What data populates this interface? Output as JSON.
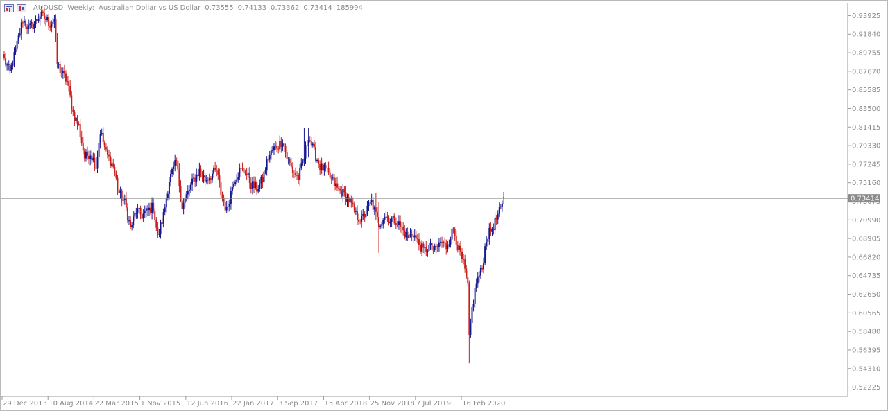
{
  "header": {
    "symbol": "AUDUSD",
    "timeframe": "Weekly:",
    "description": "Australian Dollar vs US Dollar",
    "open": "0.73555",
    "high": "0.74133",
    "low": "0.73362",
    "close": "0.73414",
    "volume": "185994"
  },
  "current_price_label": "0.73414",
  "y_axis_labels": [
    "0.93925",
    "0.91840",
    "0.89755",
    "0.87670",
    "0.85585",
    "0.83500",
    "0.81415",
    "0.79330",
    "0.77245",
    "0.75160",
    "0.73075",
    "0.70990",
    "0.68905",
    "0.66820",
    "0.64735",
    "0.62650",
    "0.60565",
    "0.58480",
    "0.56395",
    "0.54310",
    "0.52225"
  ],
  "x_axis_labels": [
    "29 Dec 2013",
    "10 Aug 2014",
    "22 Mar 2015",
    "1 Nov 2015",
    "12 Jun 2016",
    "22 Jan 2017",
    "3 Sep 2017",
    "15 Apr 2018",
    "25 Nov 2018",
    "7 Jul 2019",
    "16 Feb 2020"
  ],
  "colors": {
    "bull": "#16168f",
    "bear": "#c81e1e",
    "line": "#8c8c8c",
    "grid": "none"
  },
  "chart_data": {
    "type": "candlestick",
    "title": "AUDUSD Weekly: Australian Dollar vs US Dollar",
    "xlabel": "",
    "ylabel": "",
    "ylim": [
      0.5118,
      0.9497
    ],
    "current_price": 0.73414,
    "grid": false,
    "first_week": "29 Dec 2013",
    "anchors": [
      [
        "29 Dec 2013",
        0.89
      ],
      [
        "26 Jan 2014",
        0.875
      ],
      [
        "23 Feb 2014",
        0.9
      ],
      [
        "30 Mar 2014",
        0.935
      ],
      [
        "27 Apr 2014",
        0.925
      ],
      [
        "25 May 2014",
        0.93
      ],
      [
        "22 Jun 2014",
        0.94
      ],
      [
        "20 Jul 2014",
        0.935
      ],
      [
        "10 Aug 2014",
        0.93
      ],
      [
        "31 Aug 2014",
        0.935
      ],
      [
        "14 Sep 2014",
        0.885
      ],
      [
        "5 Oct 2014",
        0.875
      ],
      [
        "2 Nov 2014",
        0.865
      ],
      [
        "30 Nov 2014",
        0.83
      ],
      [
        "28 Dec 2014",
        0.815
      ],
      [
        "25 Jan 2015",
        0.78
      ],
      [
        "22 Feb 2015",
        0.785
      ],
      [
        "22 Mar 2015",
        0.77
      ],
      [
        "12 Apr 2015",
        0.81
      ],
      [
        "10 May 2015",
        0.785
      ],
      [
        "14 Jun 2015",
        0.77
      ],
      [
        "12 Jul 2015",
        0.74
      ],
      [
        "9 Aug 2015",
        0.73
      ],
      [
        "6 Sep 2015",
        0.7
      ],
      [
        "4 Oct 2015",
        0.72
      ],
      [
        "1 Nov 2015",
        0.715
      ],
      [
        "29 Nov 2015",
        0.72
      ],
      [
        "27 Dec 2015",
        0.725
      ],
      [
        "17 Jan 2016",
        0.69
      ],
      [
        "14 Feb 2016",
        0.715
      ],
      [
        "13 Mar 2016",
        0.755
      ],
      [
        "17 Apr 2016",
        0.775
      ],
      [
        "15 May 2016",
        0.725
      ],
      [
        "12 Jun 2016",
        0.74
      ],
      [
        "10 Jul 2016",
        0.755
      ],
      [
        "7 Aug 2016",
        0.765
      ],
      [
        "4 Sep 2016",
        0.755
      ],
      [
        "2 Oct 2016",
        0.76
      ],
      [
        "30 Oct 2016",
        0.765
      ],
      [
        "20 Nov 2016",
        0.74
      ],
      [
        "18 Dec 2016",
        0.72
      ],
      [
        "22 Jan 2017",
        0.755
      ],
      [
        "19 Feb 2017",
        0.765
      ],
      [
        "19 Mar 2017",
        0.765
      ],
      [
        "16 Apr 2017",
        0.75
      ],
      [
        "14 May 2017",
        0.745
      ],
      [
        "11 Jun 2017",
        0.755
      ],
      [
        "9 Jul 2017",
        0.78
      ],
      [
        "6 Aug 2017",
        0.79
      ],
      [
        "3 Sep 2017",
        0.795
      ],
      [
        "17 Sep 2017",
        0.8
      ],
      [
        "8 Oct 2017",
        0.78
      ],
      [
        "5 Nov 2017",
        0.765
      ],
      [
        "3 Dec 2017",
        0.757
      ],
      [
        "31 Dec 2017",
        0.78
      ],
      [
        "21 Jan 2018",
        0.805
      ],
      [
        "11 Feb 2018",
        0.79
      ],
      [
        "18 Mar 2018",
        0.77
      ],
      [
        "15 Apr 2018",
        0.765
      ],
      [
        "13 May 2018",
        0.755
      ],
      [
        "10 Jun 2018",
        0.745
      ],
      [
        "8 Jul 2018",
        0.74
      ],
      [
        "12 Aug 2018",
        0.73
      ],
      [
        "9 Sep 2018",
        0.715
      ],
      [
        "7 Oct 2018",
        0.71
      ],
      [
        "25 Nov 2018",
        0.73
      ],
      [
        "30 Dec 2018",
        0.705
      ],
      [
        "27 Jan 2019",
        0.715
      ],
      [
        "24 Feb 2019",
        0.71
      ],
      [
        "24 Mar 2019",
        0.71
      ],
      [
        "21 Apr 2019",
        0.7
      ],
      [
        "19 May 2019",
        0.69
      ],
      [
        "16 Jun 2019",
        0.695
      ],
      [
        "7 Jul 2019",
        0.685
      ],
      [
        "4 Aug 2019",
        0.675
      ],
      [
        "1 Sep 2019",
        0.68
      ],
      [
        "29 Sep 2019",
        0.675
      ],
      [
        "27 Oct 2019",
        0.685
      ],
      [
        "24 Nov 2019",
        0.68
      ],
      [
        "29 Dec 2019",
        0.7
      ],
      [
        "26 Jan 2020",
        0.675
      ],
      [
        "16 Feb 2020",
        0.66
      ],
      [
        "8 Mar 2020",
        0.635
      ],
      [
        "15 Mar 2020",
        0.575
      ],
      [
        "29 Mar 2020",
        0.61
      ],
      [
        "19 Apr 2020",
        0.64
      ],
      [
        "17 May 2020",
        0.655
      ],
      [
        "7 Jun 2020",
        0.69
      ],
      [
        "5 Jul 2020",
        0.7
      ],
      [
        "2 Aug 2020",
        0.715
      ],
      [
        "23 Aug 2020",
        0.725
      ],
      [
        "30 Aug 2020",
        0.734
      ]
    ],
    "spikes": [
      [
        "31 Dec 2017",
        0.8135,
        0.77
      ],
      [
        "21 Jan 2018",
        0.8135,
        0.78
      ],
      [
        "16 Dec 2018",
        0.74,
        0.71
      ],
      [
        "30 Dec 2018",
        0.73,
        0.673
      ],
      [
        "15 Mar 2020",
        0.63,
        0.549
      ],
      [
        "30 Aug 2020",
        0.7413,
        0.7336
      ]
    ]
  }
}
